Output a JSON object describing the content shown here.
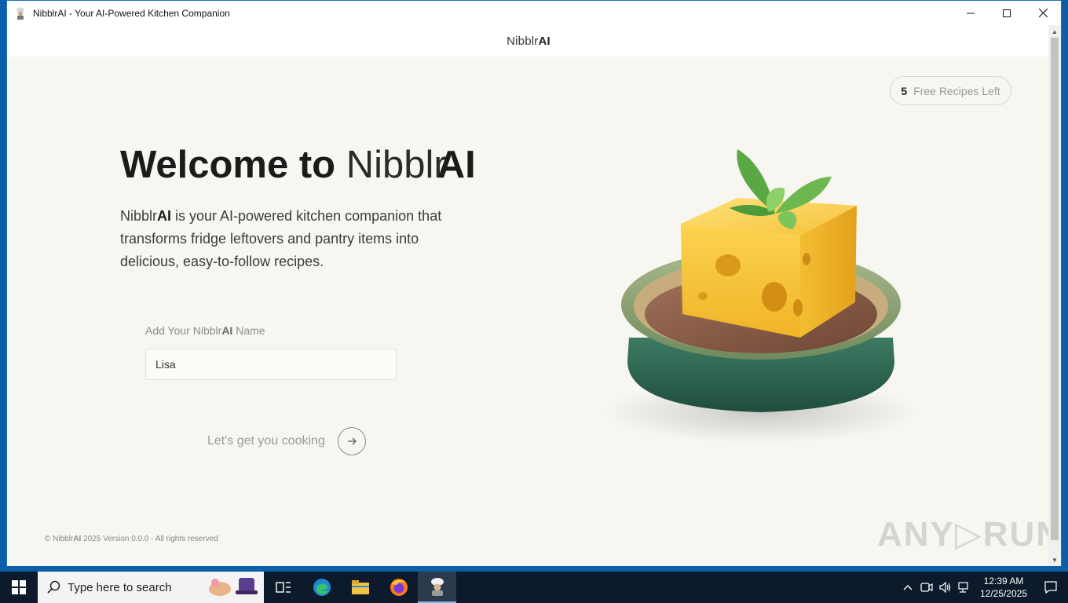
{
  "window": {
    "title": "NibblrAI - Your AI-Powered Kitchen Companion",
    "controls": {
      "minimize": "─",
      "maximize": "☐",
      "close": "✕"
    }
  },
  "header": {
    "brand_light": "Nibblr",
    "brand_bold": "AI"
  },
  "badge": {
    "count": "5",
    "label": "Free Recipes Left"
  },
  "hero": {
    "welcome_bold": "Welcome to",
    "brand_light": "Nibblr",
    "brand_bold": "AI",
    "desc_brand_light": "Nibblr",
    "desc_brand_bold": "AI",
    "description": " is your AI-powered kitchen companion that transforms fridge leftovers and pantry items into delicious, easy-to-follow recipes."
  },
  "form": {
    "label_prefix": "Add Your ",
    "label_brand_light": "Nibblr",
    "label_brand_bold": "AI",
    "label_suffix": " Name",
    "name_value": "Lisa",
    "cta_label": "Let's get you cooking"
  },
  "footer": {
    "copyright": "© ",
    "brand_light": "Nibblr",
    "brand_bold": "AI",
    "text": " 2025 Version 0.0.0 - All rights reserved"
  },
  "watermark": {
    "text": "ANY▷RUN"
  },
  "taskbar": {
    "search_placeholder": "Type here to search",
    "clock_time": "12:39 AM",
    "clock_date": "12/25/2025"
  },
  "colors": {
    "background": "#f7f6f1",
    "text_dark": "#1b1b1b",
    "muted": "#9c9c96",
    "plate_green": "#2f6a55",
    "cheese": "#f5c542"
  },
  "icons": [
    "chef-app-icon",
    "arrow-right-icon",
    "windows-start-icon",
    "search-icon",
    "task-view-icon",
    "edge-icon",
    "file-explorer-icon",
    "firefox-icon",
    "chef-taskbar-icon",
    "chevron-up-icon",
    "meet-icon",
    "volume-icon",
    "network-icon",
    "notification-icon"
  ]
}
